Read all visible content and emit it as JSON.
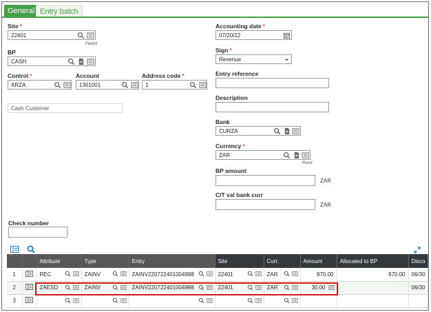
{
  "tabs": [
    {
      "label": "General"
    },
    {
      "label": "Entry batch"
    }
  ],
  "left": {
    "site": {
      "label": "Site",
      "value": "22401",
      "sub": "FedAir"
    },
    "bp": {
      "label": "BP",
      "value": "CASH"
    },
    "control": {
      "label": "Control",
      "value": "ARZA"
    },
    "account": {
      "label": "Account",
      "value": "1301001"
    },
    "address_code": {
      "label": "Address code",
      "value": "1"
    },
    "bp_name": {
      "value": "Cash Customer"
    },
    "check_number": {
      "label": "Check number",
      "value": ""
    }
  },
  "right": {
    "accounting_date": {
      "label": "Accounting date",
      "value": "07/20/22"
    },
    "sign": {
      "label": "Sign",
      "value": "Revenue"
    },
    "entry_reference": {
      "label": "Entry reference",
      "value": ""
    },
    "description": {
      "label": "Description",
      "value": ""
    },
    "bank": {
      "label": "Bank",
      "value": "CURZA"
    },
    "currency": {
      "label": "Currency",
      "value": "ZAR",
      "sub": "Rand"
    },
    "bp_amount": {
      "label": "BP amount",
      "value": "",
      "unit": "ZAR"
    },
    "ct_val": {
      "label": "C/T val bank curr",
      "value": "",
      "unit": "ZAR"
    }
  },
  "grid": {
    "headers": {
      "attribute": "Attribute",
      "type": "Type",
      "entry": "Entry",
      "site": "Site",
      "curr": "Curr.",
      "amount": "Amount",
      "allocated": "Allocated to BP",
      "disc": "Disco"
    },
    "rows": [
      {
        "num": "1",
        "attribute": "REC",
        "type": "ZAINV",
        "entry": "ZAINV220722401004988",
        "site": "22401",
        "curr": "ZAR",
        "amount": "970.00",
        "allocated": "970.00",
        "disc": "06/30"
      },
      {
        "num": "2",
        "attribute": "ZAESD",
        "type": "ZAINV",
        "entry": "ZAINV220722401004988",
        "site": "22401",
        "curr": "ZAR",
        "amount": "30.00",
        "allocated": "",
        "disc": "06/30"
      },
      {
        "num": "3",
        "attribute": "",
        "type": "",
        "entry": "",
        "site": "",
        "curr": "",
        "amount": "",
        "allocated": "",
        "disc": ""
      }
    ]
  },
  "colors": {
    "accent": "#43a047",
    "required": "#e0522c",
    "icon": "#1f7fc1",
    "highlight": "#d11a1a"
  }
}
